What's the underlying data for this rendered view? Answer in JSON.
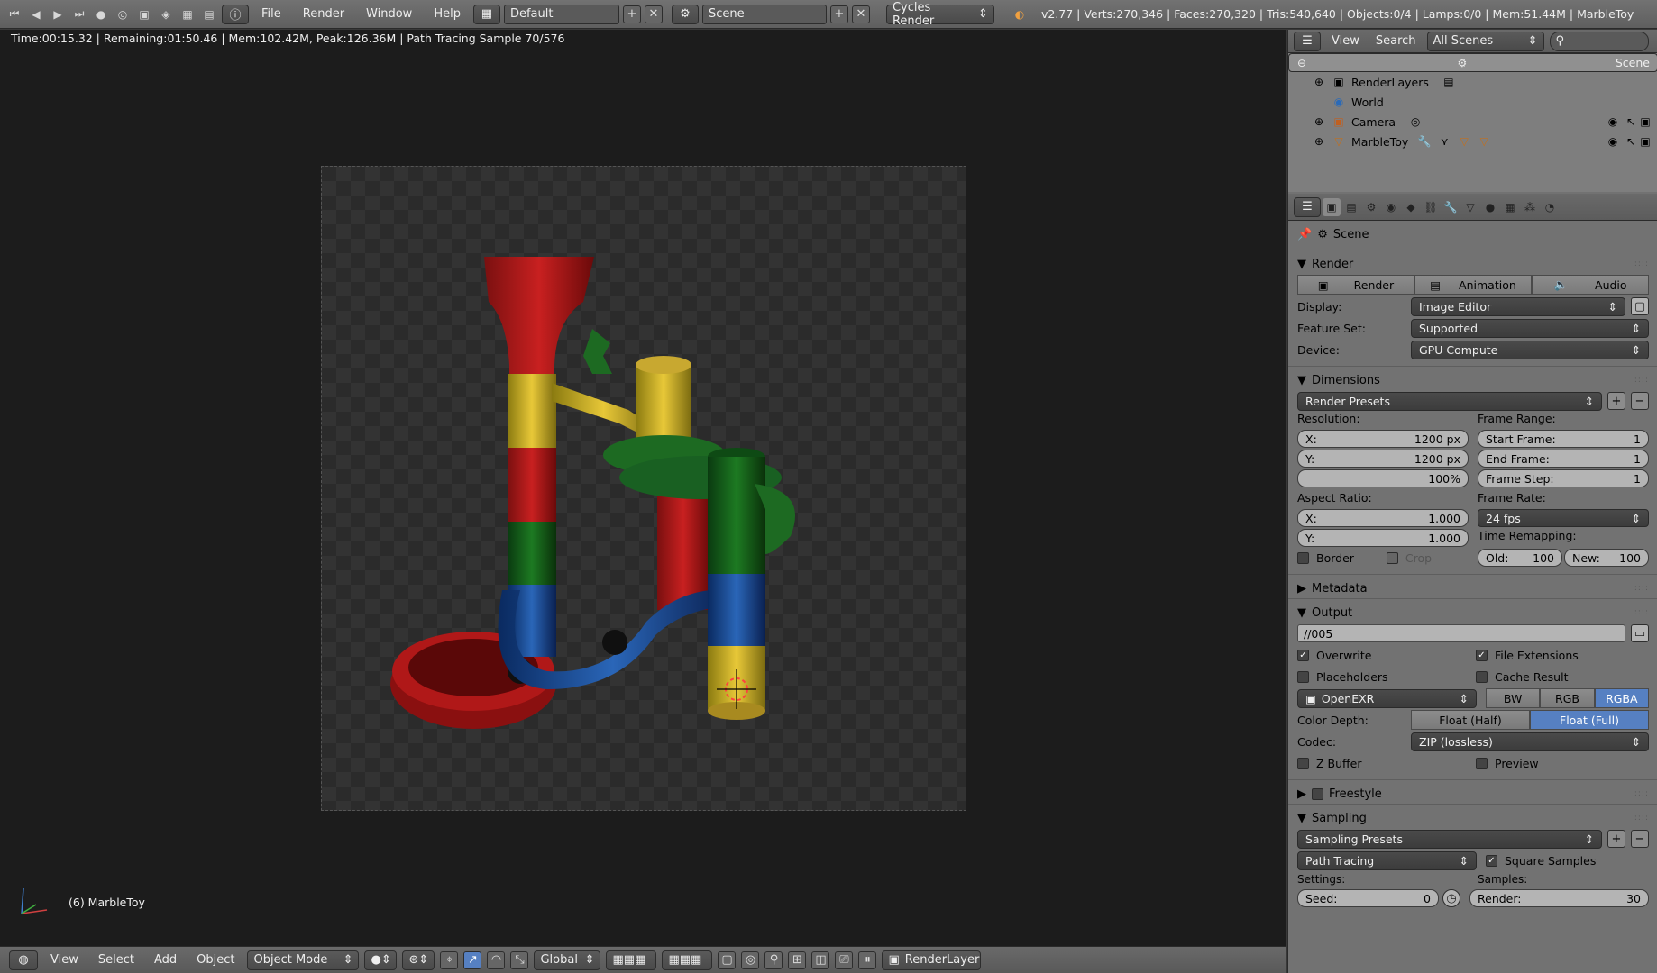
{
  "topbar": {
    "menus": [
      "File",
      "Render",
      "Window",
      "Help"
    ],
    "layout": "Default",
    "scene": "Scene",
    "engine": "Cycles Render",
    "stats": "v2.77 | Verts:270,346 | Faces:270,320 | Tris:540,640 | Objects:0/4 | Lamps:0/0 | Mem:51.44M | MarbleToy"
  },
  "viewport": {
    "render_status": "Time:00:15.32 | Remaining:01:50.46 | Mem:102.42M, Peak:126.36M | Path Tracing Sample 70/576",
    "object_label": "(6) MarbleToy"
  },
  "bottombar": {
    "menus": [
      "View",
      "Select",
      "Add",
      "Object"
    ],
    "mode": "Object Mode",
    "orientation": "Global",
    "render_layer": "RenderLayer"
  },
  "outliner": {
    "view": "View",
    "search": "Search",
    "filter": "All Scenes",
    "items": [
      "Scene",
      "RenderLayers",
      "World",
      "Camera",
      "MarbleToy"
    ]
  },
  "properties": {
    "context": "Scene",
    "render": {
      "title": "Render",
      "buttons": [
        "Render",
        "Animation",
        "Audio"
      ],
      "display_label": "Display:",
      "display": "Image Editor",
      "feature_set_label": "Feature Set:",
      "feature_set": "Supported",
      "device_label": "Device:",
      "device": "GPU Compute"
    },
    "dimensions": {
      "title": "Dimensions",
      "presets": "Render Presets",
      "resolution_label": "Resolution:",
      "res_x_label": "X:",
      "res_x": "1200 px",
      "res_y_label": "Y:",
      "res_y": "1200 px",
      "res_pct": "100%",
      "frame_range_label": "Frame Range:",
      "start_label": "Start Frame:",
      "start": "1",
      "end_label": "End Frame:",
      "end": "1",
      "step_label": "Frame Step:",
      "step": "1",
      "aspect_label": "Aspect Ratio:",
      "aspect_x_label": "X:",
      "aspect_x": "1.000",
      "aspect_y_label": "Y:",
      "aspect_y": "1.000",
      "frame_rate_label": "Frame Rate:",
      "frame_rate": "24 fps",
      "time_remap_label": "Time Remapping:",
      "old_label": "Old:",
      "old": "100",
      "new_label": "New:",
      "new": "100",
      "border": "Border",
      "crop": "Crop"
    },
    "metadata": {
      "title": "Metadata"
    },
    "output": {
      "title": "Output",
      "path": "//005",
      "overwrite": "Overwrite",
      "file_extensions": "File Extensions",
      "placeholders": "Placeholders",
      "cache_result": "Cache Result",
      "format": "OpenEXR",
      "color_modes": [
        "BW",
        "RGB",
        "RGBA"
      ],
      "color_depth_label": "Color Depth:",
      "depths": [
        "Float (Half)",
        "Float (Full)"
      ],
      "codec_label": "Codec:",
      "codec": "ZIP (lossless)",
      "zbuffer": "Z Buffer",
      "preview": "Preview"
    },
    "freestyle": {
      "title": "Freestyle"
    },
    "sampling": {
      "title": "Sampling",
      "presets": "Sampling Presets",
      "integrator": "Path Tracing",
      "square_samples": "Square Samples",
      "settings_label": "Settings:",
      "samples_label": "Samples:",
      "seed_label": "Seed:",
      "seed": "0",
      "render_label": "Render:",
      "render": "30"
    }
  }
}
